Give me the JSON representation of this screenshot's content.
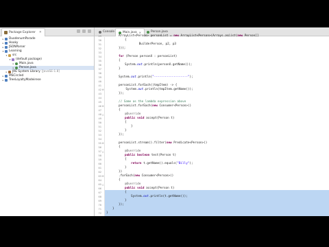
{
  "explorer": {
    "title": "Package Explorer",
    "items": [
      {
        "label": "DuodenumParade",
        "depth": 0,
        "type": "proj",
        "twisty": "▸"
      },
      {
        "label": "Hooky",
        "depth": 0,
        "type": "proj",
        "twisty": "▸"
      },
      {
        "label": "JSONParser",
        "depth": 0,
        "type": "proj",
        "twisty": "▸"
      },
      {
        "label": "Learning",
        "depth": 0,
        "type": "proj",
        "twisty": "▾"
      },
      {
        "label": "src",
        "depth": 1,
        "type": "src",
        "twisty": "▾"
      },
      {
        "label": "(default package)",
        "depth": 2,
        "type": "pkg",
        "twisty": "▾"
      },
      {
        "label": "Main.java",
        "depth": 3,
        "type": "java",
        "twisty": "▸"
      },
      {
        "label": "Person.java",
        "depth": 3,
        "type": "java",
        "twisty": "▸",
        "selected": true
      },
      {
        "label": "JRE System Library",
        "extra": "[JavaSE-1.8]",
        "depth": 1,
        "type": "lib",
        "twisty": "▸"
      },
      {
        "label": "MSCircled",
        "depth": 0,
        "type": "proj",
        "twisty": "▸"
      },
      {
        "label": "TreeLoyaltyMadeirese",
        "depth": 0,
        "type": "proj",
        "twisty": "▸"
      }
    ]
  },
  "tabs": [
    {
      "label": "Console",
      "active": false
    },
    {
      "label": "Main.java",
      "active": true
    },
    {
      "label": "Person.java",
      "active": false
    }
  ],
  "code_lines": [
    {
      "n": "29",
      "html": "ArrayList&lt;Person&gt; personList = <span class=\"kw\">new</span> ArrayList&lt;Person&gt;(Arrays.<i>asList</i>(<span class=\"kw\">new</span> Person[]",
      "indent": 2
    },
    {
      "n": "30",
      "html": "{",
      "indent": 3
    },
    {
      "n": "31",
      "html": "        BuilderPerson, p2, p3",
      "indent": 3
    },
    {
      "n": "32",
      "html": "}));",
      "indent": 2
    },
    {
      "n": "33",
      "html": "",
      "indent": 0
    },
    {
      "n": "34",
      "html": "<span class=\"kw\">for</span> (Person personX : personList)",
      "indent": 2
    },
    {
      "n": "35",
      "html": "{",
      "indent": 2
    },
    {
      "n": "36",
      "html": "System.<span class=\"fld\"><i>out</i></span>.println(personX.getName());",
      "indent": 3
    },
    {
      "n": "37",
      "html": "}",
      "indent": 2
    },
    {
      "n": "38",
      "html": "",
      "indent": 0
    },
    {
      "n": "39",
      "html": "System.<span class=\"fld\"><i>out</i></span>.println(<span class=\"str\">\"-------------------\"</span>);",
      "indent": 2
    },
    {
      "n": "40",
      "html": "",
      "indent": 0
    },
    {
      "n": "41",
      "html": "personList.forEach((tmpItem) -&gt; {",
      "indent": 2
    },
    {
      "n": "42",
      "html": "    System.<span class=\"fld\"><i>out</i></span>.println(tmpItem.getName());",
      "indent": 2,
      "marker": "⊖"
    },
    {
      "n": "43",
      "html": "});",
      "indent": 2
    },
    {
      "n": "44",
      "html": "",
      "indent": 0
    },
    {
      "n": "45",
      "html": "<span class=\"cm\">// Same as the lambda expression above</span>",
      "indent": 2
    },
    {
      "n": "46",
      "html": "personList.forEach(<span class=\"kw\">new</span> Consumer&lt;Person&gt;()",
      "indent": 2,
      "marker": "⊖"
    },
    {
      "n": "47",
      "html": "{",
      "indent": 2
    },
    {
      "n": "48",
      "html": "<span class=\"an\">@Override</span>",
      "indent": 3,
      "marker": "△"
    },
    {
      "n": "49",
      "html": "<span class=\"kw\">public</span> <span class=\"kw\">void</span> accept(Person t)",
      "indent": 3
    },
    {
      "n": "50",
      "html": "{",
      "indent": 3
    },
    {
      "n": "51",
      "html": "}",
      "indent": 4
    },
    {
      "n": "52",
      "html": "}",
      "indent": 3
    },
    {
      "n": "53",
      "html": "});",
      "indent": 2
    },
    {
      "n": "54",
      "html": "",
      "indent": 0
    },
    {
      "n": "55",
      "html": "personList.stream().filter(<span class=\"kw\">new</span> Predicate&lt;Person&gt;()",
      "indent": 2,
      "marker": "⊖"
    },
    {
      "n": "56",
      "html": "{",
      "indent": 2
    },
    {
      "n": "57",
      "html": "<span class=\"an\">@Override</span>",
      "indent": 3,
      "marker": "△"
    },
    {
      "n": "58",
      "html": "<span class=\"kw\">public</span> <span class=\"kw\">boolean</span> test(Person t)",
      "indent": 3
    },
    {
      "n": "59",
      "html": "{",
      "indent": 3
    },
    {
      "n": "60",
      "html": "<span class=\"kw\">return</span> t.getName().equals(<span class=\"str\">\"Billy\"</span>);",
      "indent": 4
    },
    {
      "n": "61",
      "html": "}",
      "indent": 3
    },
    {
      "n": "62",
      "html": "})",
      "indent": 2
    },
    {
      "n": "63",
      "html": ".forEach(<span class=\"kw\">new</span> Consumer&lt;Person&gt;()",
      "indent": 2,
      "hl": true,
      "marker": "⊖"
    },
    {
      "n": "64",
      "html": "{",
      "indent": 2,
      "hl": true
    },
    {
      "n": "65",
      "html": "<span class=\"an\">@Override</span>",
      "indent": 3,
      "hl": true,
      "marker": "△"
    },
    {
      "n": "66",
      "html": "<span class=\"kw\">public</span> <span class=\"kw\">void</span> accept(Person t)",
      "indent": 3,
      "hl": true
    },
    {
      "n": "67",
      "html": "{",
      "indent": 3,
      "hl": true
    },
    {
      "n": "68",
      "html": "System.<span class=\"fld\"><i>out</i></span>.println(t.getName());",
      "indent": 4,
      "hl": true
    },
    {
      "n": "69",
      "html": "}",
      "indent": 3,
      "hl": true
    },
    {
      "n": "70",
      "html": "});",
      "indent": 2,
      "hl": true
    },
    {
      "n": "71",
      "html": "}",
      "indent": 1
    },
    {
      "n": "72",
      "html": "}",
      "indent": 0
    }
  ]
}
